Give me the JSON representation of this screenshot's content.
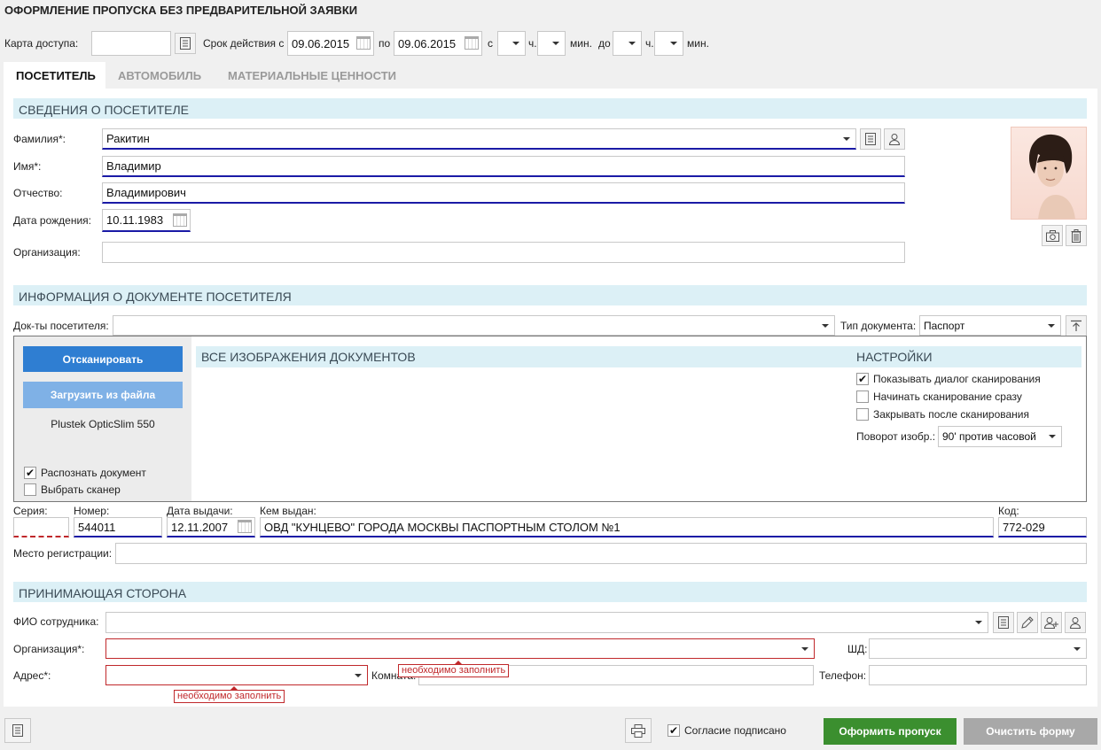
{
  "title": "ОФОРМЛЕНИЕ ПРОПУСКА БЕЗ ПРЕДВАРИТЕЛЬНОЙ ЗАЯВКИ",
  "header_row": {
    "card_label": "Карта доступа:",
    "card_value": "",
    "validity_label": "Срок действия с",
    "date_from": "09.06.2015",
    "to_label": "по",
    "date_to": "09.06.2015",
    "from_label": "с",
    "hour_label": "ч.",
    "min_label": "мин.",
    "until_label": "до",
    "hour_label2": "ч.",
    "min_label2": "мин."
  },
  "tabs": [
    {
      "label": "ПОСЕТИТЕЛЬ",
      "active": true
    },
    {
      "label": "АВТОМОБИЛЬ",
      "active": false
    },
    {
      "label": "МАТЕРИАЛЬНЫЕ ЦЕННОСТИ",
      "active": false
    }
  ],
  "visitor": {
    "section_title": "СВЕДЕНИЯ О ПОСЕТИТЕЛЕ",
    "surname_label": "Фамилия*:",
    "surname": "Ракитин",
    "name_label": "Имя*:",
    "name": "Владимир",
    "patronymic_label": "Отчество:",
    "patronymic": "Владимирович",
    "birthdate_label": "Дата рождения:",
    "birthdate": "10.11.1983",
    "org_label": "Организация:",
    "org": ""
  },
  "document": {
    "section_title": "ИНФОРМАЦИЯ О ДОКУМЕНТЕ ПОСЕТИТЕЛЯ",
    "docs_label": "Док-ты посетителя:",
    "docs_value": "",
    "doctype_label": "Тип документа:",
    "doctype_value": "Паспорт",
    "scan_button": "Отсканировать",
    "upload_button": "Загрузить из файла",
    "scanner_name": "Plustek OpticSlim 550",
    "recognize_label": "Распознать документ",
    "recognize_checked": true,
    "choose_scanner_label": "Выбрать сканер",
    "choose_scanner_checked": false,
    "images_title": "ВСЕ ИЗОБРАЖЕНИЯ ДОКУМЕНТОВ",
    "settings_title": "НАСТРОЙКИ",
    "settings": [
      {
        "label": "Показывать диалог сканирования",
        "checked": true
      },
      {
        "label": "Начинать сканирование сразу",
        "checked": false
      },
      {
        "label": "Закрывать после сканирования",
        "checked": false
      }
    ],
    "rotation_label": "Поворот изобр.:",
    "rotation_value": "90' против часовой",
    "series_label": "Серия:",
    "series": "",
    "number_label": "Номер:",
    "number": "544011",
    "issue_date_label": "Дата выдачи:",
    "issue_date": "12.11.2007",
    "issued_by_label": "Кем выдан:",
    "issued_by": "ОВД \"КУНЦЕВО\" ГОРОДА МОСКВЫ ПАСПОРТНЫМ СТОЛОМ №1",
    "code_label": "Код:",
    "code": "772-029",
    "registration_label": "Место регистрации:",
    "registration": ""
  },
  "host": {
    "section_title": "ПРИНИМАЮЩАЯ СТОРОНА",
    "employee_label": "ФИО сотрудника:",
    "employee": "",
    "org_label": "Организация*:",
    "org": "",
    "shd_label": "ШД:",
    "shd": "",
    "address_label": "Адрес*:",
    "address": "",
    "room_label": "Комната:",
    "room": "",
    "phone_label": "Телефон:",
    "phone": "",
    "required_msg": "необходимо заполнить"
  },
  "footer": {
    "consent_label": "Согласие подписано",
    "consent_checked": true,
    "submit_button": "Оформить пропуск",
    "clear_button": "Очистить форму"
  },
  "colors": {
    "accent_blue": "#2f7ed2",
    "accent_blue_disabled": "#7fb1e6",
    "section_bg": "#dcf0f6",
    "submit_green": "#3b8f2f",
    "clear_gray": "#a8a8a8",
    "error_red": "#c0282b",
    "focus_underline": "#1a1aa6"
  },
  "icons": [
    "list-icon",
    "person-icon",
    "calendar-icon",
    "camera-icon",
    "trash-icon",
    "upload-icon",
    "edit-icon",
    "add-person-icon",
    "print-icon",
    "checkmark-icon"
  ]
}
